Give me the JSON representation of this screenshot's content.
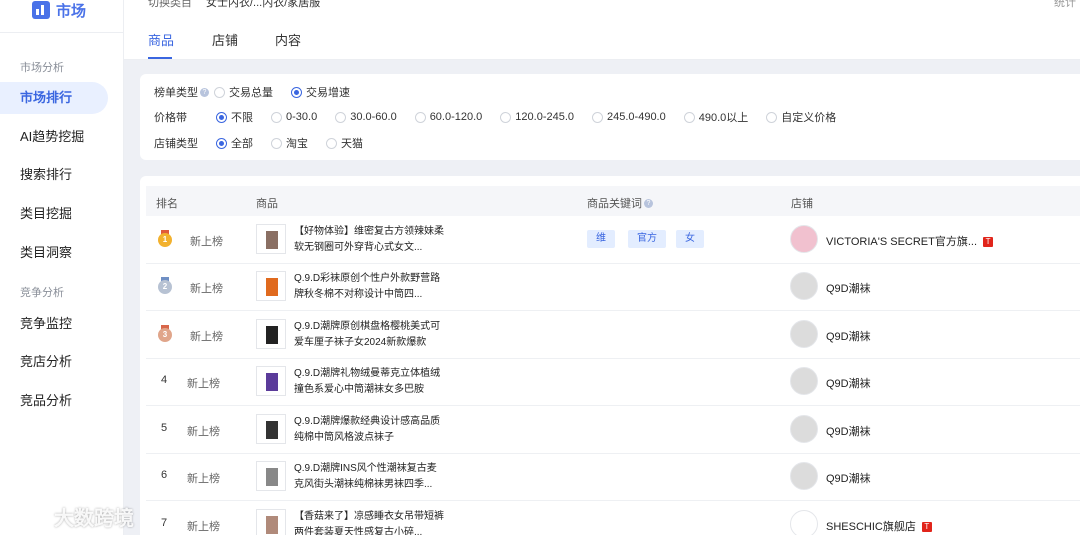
{
  "app": {
    "logo_text": "市场"
  },
  "topbar": {
    "category_label": "切换类目",
    "category_value": "女士内衣/...内衣/家居服",
    "right_text": "统计"
  },
  "sidebar": {
    "section1": "市场分析",
    "items1": [
      {
        "label": "市场排行",
        "active": true
      },
      {
        "label": "AI趋势挖掘"
      },
      {
        "label": "搜索排行"
      },
      {
        "label": "类目挖掘"
      },
      {
        "label": "类目洞察"
      }
    ],
    "section2": "竞争分析",
    "items2": [
      {
        "label": "竞争监控"
      },
      {
        "label": "竞店分析"
      },
      {
        "label": "竞品分析"
      }
    ]
  },
  "tabs": [
    {
      "label": "商品",
      "active": true
    },
    {
      "label": "店铺"
    },
    {
      "label": "内容"
    }
  ],
  "filters": {
    "list_type": {
      "label": "榜单类型",
      "options": [
        "交易总量",
        "交易增速"
      ],
      "selected": 1
    },
    "price_band": {
      "label": "价格带",
      "options": [
        "不限",
        "0-30.0",
        "30.0-60.0",
        "60.0-120.0",
        "120.0-245.0",
        "245.0-490.0",
        "490.0以上",
        "自定义价格"
      ],
      "selected": 0
    },
    "shop_type": {
      "label": "店铺类型",
      "options": [
        "全部",
        "淘宝",
        "天猫"
      ],
      "selected": 0
    }
  },
  "table": {
    "headers": {
      "rank": "排名",
      "product": "商品",
      "keywords": "商品关键词",
      "shop": "店铺"
    },
    "rows": [
      {
        "rank": "1",
        "medal": "gold",
        "tag": "新上榜",
        "title": "【好物体验】维密复古方领辣妹柔软无钢圈可外穿背心式女文...",
        "keywords": [
          "维",
          "官方",
          "女"
        ],
        "shop": "VICTORIA'S SECRET官方旗...",
        "tmall": "T",
        "thumb": "photo"
      },
      {
        "rank": "2",
        "medal": "silver",
        "tag": "新上榜",
        "title": "Q.9.D彩袜原创个性户外款野营路牌秋冬棉不对称设计中筒四...",
        "keywords": [],
        "shop": "Q9D潮袜",
        "thumb": "socks-orange"
      },
      {
        "rank": "3",
        "medal": "bronze",
        "tag": "新上榜",
        "title": "Q.9.D潮牌原创棋盘格樱桃美式可爱车厘子袜子女2024新款爆款",
        "keywords": [],
        "shop": "Q9D潮袜",
        "thumb": "socks-black"
      },
      {
        "rank": "4",
        "tag": "新上榜",
        "title": "Q.9.D潮牌礼物绒曼蒂克立体植绒撞色系爱心中筒潮袜女多巴胺",
        "keywords": [],
        "shop": "Q9D潮袜",
        "thumb": "socks-purple"
      },
      {
        "rank": "5",
        "tag": "新上榜",
        "title": "Q.9.D潮牌爆款经典设计感高品质纯棉中筒风格波点袜子",
        "keywords": [],
        "shop": "Q9D潮袜",
        "thumb": "socks-dots"
      },
      {
        "rank": "6",
        "tag": "新上榜",
        "title": "Q.9.D潮牌INS风个性潮袜复古麦克风街头潮袜纯棉袜男袜四季...",
        "keywords": [],
        "shop": "Q9D潮袜",
        "thumb": "socks-grey"
      },
      {
        "rank": "7",
        "tag": "新上榜",
        "title": "【香菇来了】凉感睡衣女吊带短裤两件套装夏天性感复古小碎...",
        "keywords": [],
        "shop": "SHESCHIC旗舰店",
        "tmall": "T",
        "thumb": "photo2"
      }
    ]
  },
  "watermark": {
    "text": "大数跨境"
  },
  "colors": {
    "accent": "#3a66e0",
    "tmall": "#e1251b"
  }
}
